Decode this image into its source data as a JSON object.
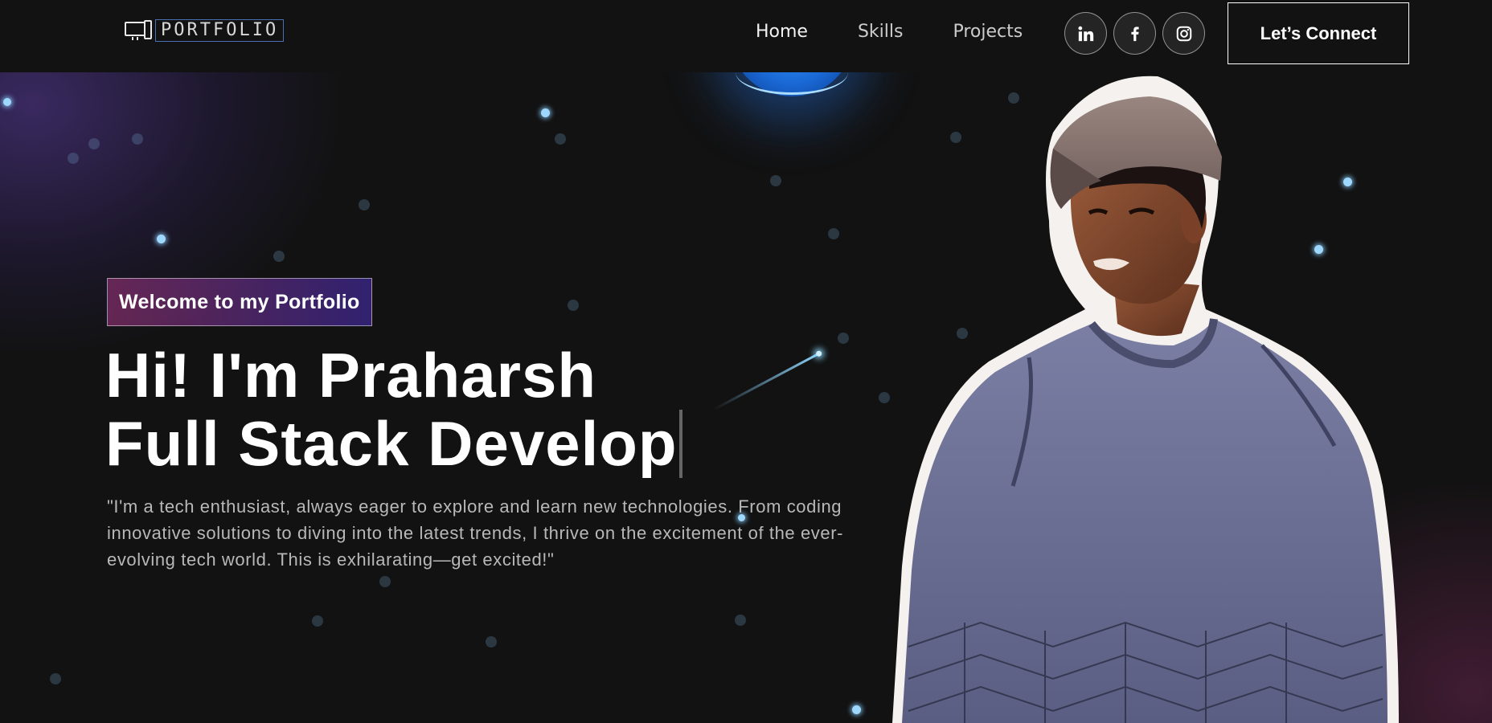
{
  "nav": {
    "logo_text": "PORTFOLIO",
    "links": [
      "Home",
      "Skills",
      "Projects"
    ],
    "socials": [
      "linkedin-icon",
      "facebook-icon",
      "instagram-icon"
    ],
    "connect_label": "Let’s Connect"
  },
  "hero": {
    "tagline": "Welcome to my Portfolio",
    "greeting": "Hi! I'm Praharsh",
    "role_typed": "Full Stack Develop",
    "bio": "\"I'm a tech enthusiast, always eager to explore and learn new technologies. From coding innovative solutions to diving into the latest trends, I thrive on the excitement of the ever-evolving tech world. This is exhilarating—get excited!\""
  },
  "colors": {
    "background": "#121212",
    "tagline_gradient_start": "#aa367c",
    "tagline_gradient_end": "#4a2fbd",
    "accent_glow": "#3aa3ff"
  }
}
